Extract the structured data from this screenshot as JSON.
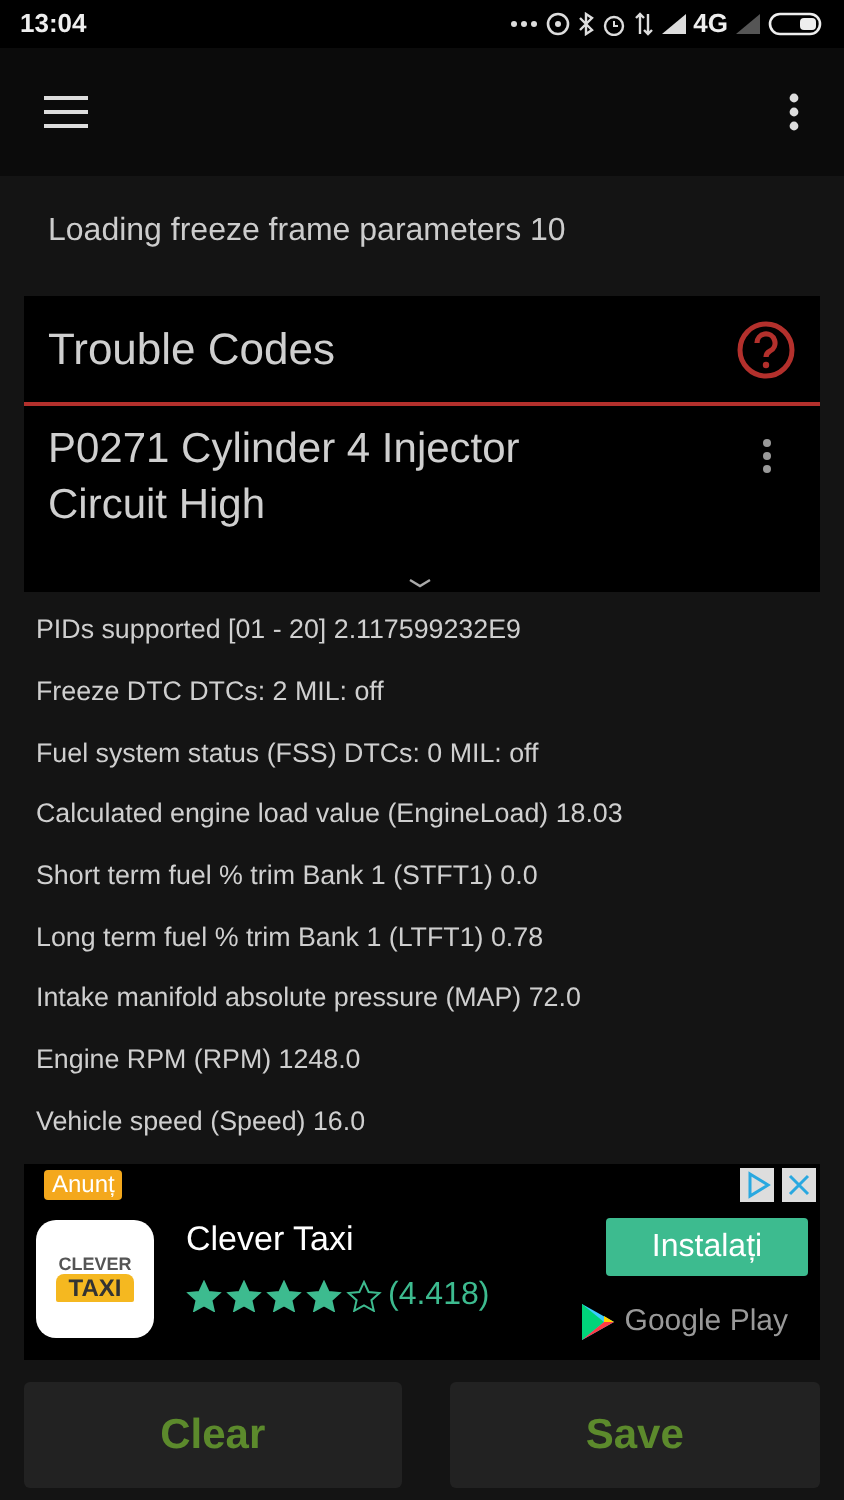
{
  "status_bar": {
    "time": "13:04",
    "network": "4G"
  },
  "loading_text": "Loading freeze frame parameters 10",
  "trouble_codes": {
    "title": "Trouble Codes",
    "codes": [
      {
        "text": "P0271 Cylinder 4 Injector Circuit High"
      }
    ]
  },
  "pids": [
    "PIDs supported [01 - 20] 2.117599232E9",
    "Freeze DTC DTCs: 2 MIL: off",
    "Fuel system status (FSS) DTCs: 0 MIL: off",
    "Calculated engine load value (EngineLoad) 18.03",
    "Short term fuel % trim Bank 1 (STFT1) 0.0",
    "Long term fuel % trim Bank 1 (LTFT1) 0.78",
    "Intake manifold absolute pressure (MAP) 72.0",
    "Engine RPM (RPM) 1248.0",
    "Vehicle speed (Speed) 16.0"
  ],
  "ad": {
    "badge": "Anunț",
    "icon_text": [
      "CLEVER",
      "TAXI"
    ],
    "app_name": "Clever Taxi",
    "stars": 4,
    "rating": "(4.418)",
    "install": "Instalați",
    "store": "Google Play"
  },
  "buttons": [
    "Clear",
    "Save"
  ]
}
